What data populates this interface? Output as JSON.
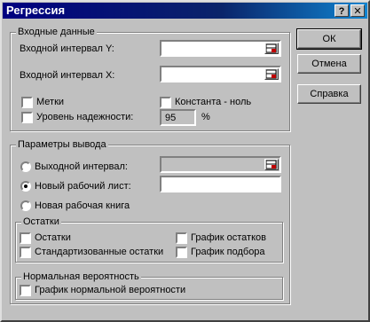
{
  "window": {
    "title": "Регрессия",
    "help_glyph": "?",
    "close_glyph": "✕"
  },
  "input_group": {
    "legend": "Входные данные",
    "input_y_label": "Входной интервал Y:",
    "input_x_label": "Входной интервал X:",
    "labels_cb": "Метки",
    "constant_zero_cb": "Константа - ноль",
    "confidence_cb": "Уровень надежности:",
    "confidence_value": "95",
    "percent": "%"
  },
  "output_group": {
    "legend": "Параметры вывода",
    "output_range": "Выходной интервал:",
    "new_sheet": "Новый рабочий лист:",
    "new_book": "Новая рабочая книга",
    "selected": "new_sheet"
  },
  "residuals_group": {
    "legend": "Остатки",
    "residuals": "Остатки",
    "std_residuals": "Стандартизованные остатки",
    "residual_plot": "График остатков",
    "fit_plot": "График подбора"
  },
  "normal_group": {
    "legend": "Нормальная вероятность",
    "normal_plot": "График нормальной вероятности"
  },
  "buttons": {
    "ok": "ОК",
    "cancel": "Отмена",
    "help": "Справка"
  }
}
